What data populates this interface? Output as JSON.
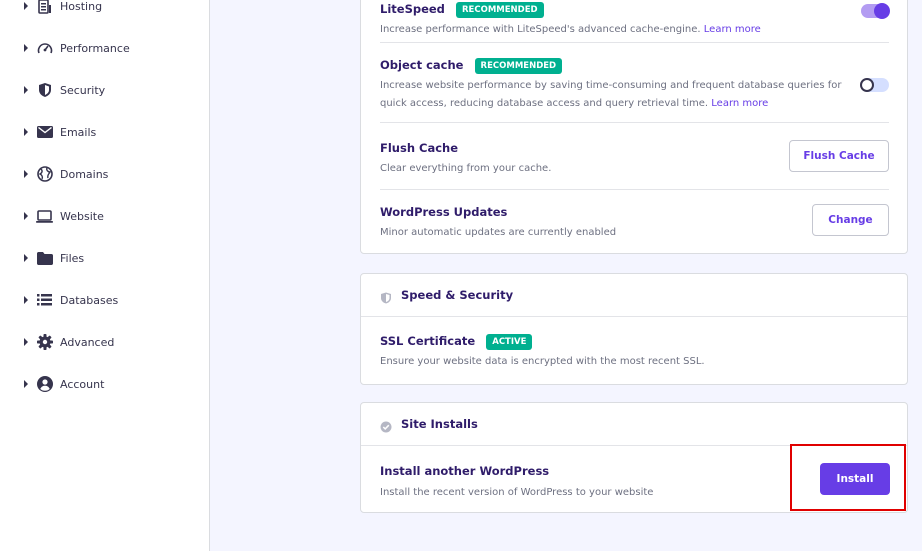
{
  "sidebar": {
    "items": [
      {
        "label": "Hosting",
        "icon": "hosting-icon"
      },
      {
        "label": "Performance",
        "icon": "speedometer-icon"
      },
      {
        "label": "Security",
        "icon": "shield-icon"
      },
      {
        "label": "Emails",
        "icon": "envelope-icon"
      },
      {
        "label": "Domains",
        "icon": "globe-icon"
      },
      {
        "label": "Website",
        "icon": "laptop-icon"
      },
      {
        "label": "Files",
        "icon": "folder-icon"
      },
      {
        "label": "Databases",
        "icon": "database-icon"
      },
      {
        "label": "Advanced",
        "icon": "gear-icon"
      },
      {
        "label": "Account",
        "icon": "user-circle-icon"
      }
    ]
  },
  "cache_card": {
    "litespeed": {
      "title": "LiteSpeed",
      "badge": "RECOMMENDED",
      "desc": "Increase performance with LiteSpeed's advanced cache-engine.",
      "link": "Learn more",
      "enabled": true
    },
    "object_cache": {
      "title": "Object cache",
      "badge": "RECOMMENDED",
      "desc": "Increase website performance by saving time-consuming and frequent database queries for quick access, reducing database access and query retrieval time.",
      "link": "Learn more",
      "enabled": false
    },
    "flush": {
      "title": "Flush Cache",
      "desc": "Clear everything from your cache.",
      "button": "Flush Cache"
    },
    "updates": {
      "title": "WordPress Updates",
      "desc": "Minor automatic updates are currently enabled",
      "button": "Change"
    }
  },
  "speed_security": {
    "header": "Speed & Security",
    "ssl": {
      "title": "SSL Certificate",
      "badge": "ACTIVE",
      "desc": "Ensure your website data is encrypted with the most recent SSL."
    }
  },
  "site_installs": {
    "header": "Site Installs",
    "install": {
      "title": "Install another WordPress",
      "desc": "Install the recent version of WordPress to your website",
      "button": "Install"
    }
  },
  "colors": {
    "accent": "#673de6",
    "badge": "#00b090",
    "highlight": "#e00000",
    "text_dark": "#2f1c6a",
    "text_muted": "#6d7081"
  }
}
